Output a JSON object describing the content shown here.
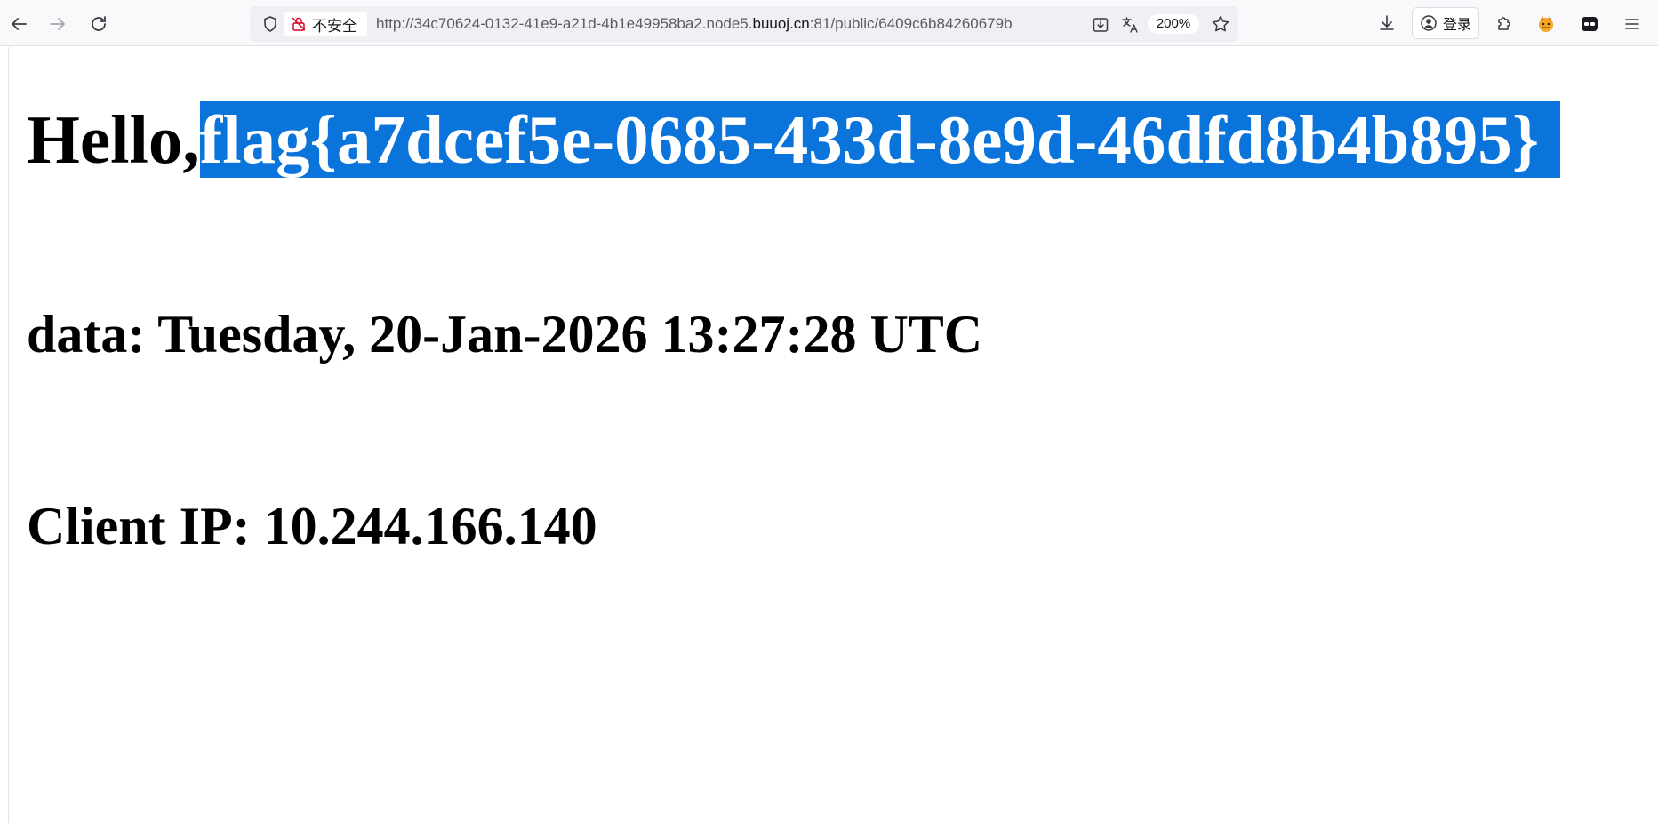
{
  "browser": {
    "security_label": "不安全",
    "url_prefix": "http://34c70624-0132-41e9-a21d-4b1e49958ba2.node5.",
    "url_host": "buuoj.cn",
    "url_suffix": ":81/public/6409c6b84260679b",
    "zoom": "200%",
    "login_label": "登录"
  },
  "page": {
    "greeting": "Hello,",
    "flag": "flag{a7dcef5e-0685-433d-8e9d-46dfd8b4b895}",
    "data_line": "data: Tuesday, 20-Jan-2026 13:27:28 UTC",
    "ip_line": "Client IP: 10.244.166.140"
  }
}
